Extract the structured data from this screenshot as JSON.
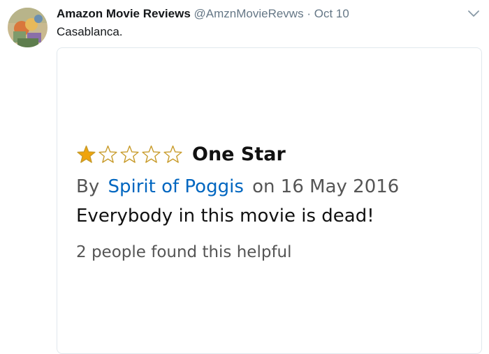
{
  "tweet": {
    "display_name": "Amazon Movie Reviews",
    "handle": "@AmznMovieRevws",
    "separator": "·",
    "timestamp": "Oct 10",
    "text": "Casablanca.",
    "avatar_icon": "painting-avatar-icon",
    "menu_icon": "chevron-down-icon"
  },
  "review": {
    "rating": 1,
    "max_rating": 5,
    "star_color": "#f0a40b",
    "star_outline_color": "#c89b2a",
    "title": "One Star",
    "by_label": "By",
    "author": "Spirit of Poggis",
    "date_prefix": "on",
    "date": "16 May 2016",
    "body": "Everybody in this movie is dead!",
    "helpful": "2 people found this helpful"
  },
  "colors": {
    "link": "#0066c0",
    "muted": "#657786",
    "card_border": "#e1e8ed"
  }
}
